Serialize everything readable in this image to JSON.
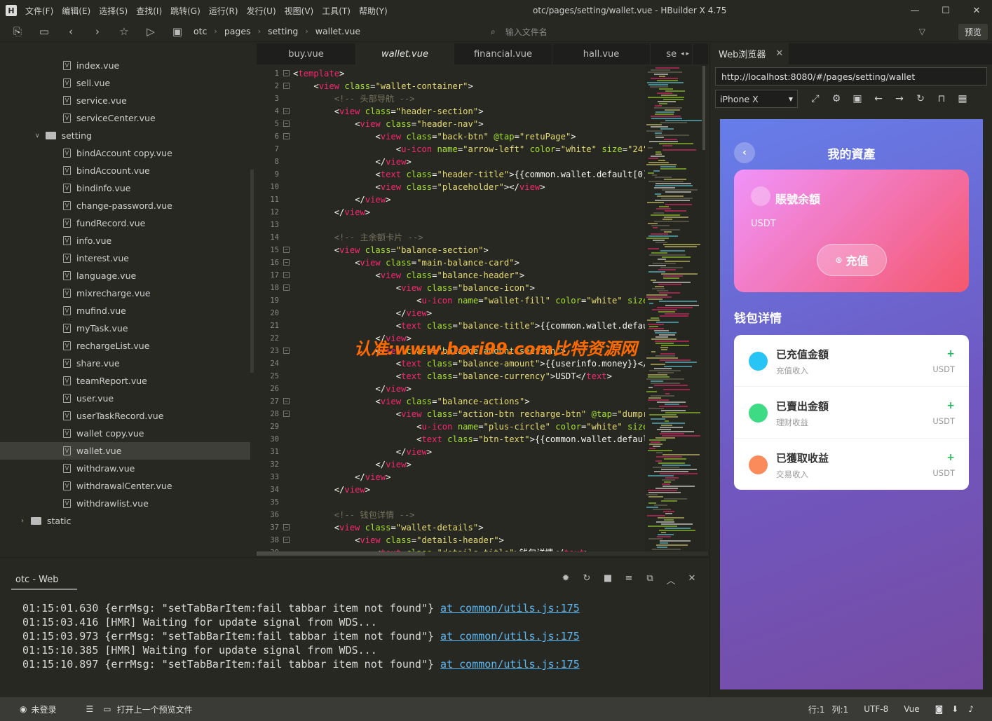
{
  "menubar": {
    "logo": "H",
    "items": [
      "文件(F)",
      "编辑(E)",
      "选择(S)",
      "查找(I)",
      "跳转(G)",
      "运行(R)",
      "发行(U)",
      "视图(V)",
      "工具(T)",
      "帮助(Y)"
    ],
    "window_title": "otc/pages/setting/wallet.vue - HBuilder X 4.75"
  },
  "toolbar": {
    "breadcrumbs": [
      "otc",
      "pages",
      "setting",
      "wallet.vue"
    ],
    "file_search_placeholder": "输入文件名",
    "preview_label": "预览"
  },
  "sidebar": {
    "files_top": [
      "index.vue",
      "sell.vue",
      "service.vue",
      "serviceCenter.vue"
    ],
    "folder": "setting",
    "files_setting": [
      "bindAccount copy.vue",
      "bindAccount.vue",
      "bindinfo.vue",
      "change-password.vue",
      "fundRecord.vue",
      "info.vue",
      "interest.vue",
      "language.vue",
      "mixrecharge.vue",
      "mufind.vue",
      "myTask.vue",
      "rechargeList.vue",
      "share.vue",
      "teamReport.vue",
      "user.vue",
      "userTaskRecord.vue",
      "wallet copy.vue",
      "wallet.vue",
      "withdraw.vue",
      "withdrawalCenter.vue",
      "withdrawlist.vue"
    ],
    "selected": "wallet.vue",
    "folder_static": "static"
  },
  "tabs": [
    "buy.vue",
    "wallet.vue",
    "financial.vue",
    "hall.vue",
    "se"
  ],
  "active_tab": "wallet.vue",
  "editor": {
    "watermark": "认准:www.bori99.com比特资源网"
  },
  "console": {
    "tab_label": "otc - Web",
    "logs": [
      {
        "time": "01:15:01.630",
        "text": "{errMsg: \"setTabBarItem:fail tabbar item not found\"}",
        "link": "at common/utils.js:175"
      },
      {
        "time": "01:15:03.416",
        "text": "[HMR] Waiting for update signal from WDS...",
        "link": ""
      },
      {
        "time": "01:15:03.973",
        "text": "{errMsg: \"setTabBarItem:fail tabbar item not found\"}",
        "link": "at common/utils.js:175"
      },
      {
        "time": "01:15:10.385",
        "text": "[HMR] Waiting for update signal from WDS...",
        "link": ""
      },
      {
        "time": "01:15:10.897",
        "text": "{errMsg: \"setTabBarItem:fail tabbar item not found\"}",
        "link": "at common/utils.js:175"
      }
    ]
  },
  "statusbar": {
    "login": "未登录",
    "open_last": "打开上一个预览文件",
    "row": "行:1",
    "col": "列:1",
    "encoding": "UTF-8",
    "lang": "Vue"
  },
  "browser": {
    "tab_label": "Web浏览器",
    "url": "http://localhost:8080/#/pages/setting/wallet",
    "device": "iPhone X",
    "app": {
      "title": "我的資產",
      "balance_title": "賬號余額",
      "currency": "USDT",
      "recharge_label": "充值",
      "details_title": "钱包详情",
      "rows": [
        {
          "title": "已充值金額",
          "sub": "充值收入",
          "plus": "+",
          "cur": "USDT",
          "color": "#27c4f5"
        },
        {
          "title": "已賣出金額",
          "sub": "理财收益",
          "plus": "+",
          "cur": "USDT",
          "color": "#3ddc84"
        },
        {
          "title": "已獲取收益",
          "sub": "交易收入",
          "plus": "+",
          "cur": "USDT",
          "color": "#fb8b5a"
        }
      ]
    }
  }
}
